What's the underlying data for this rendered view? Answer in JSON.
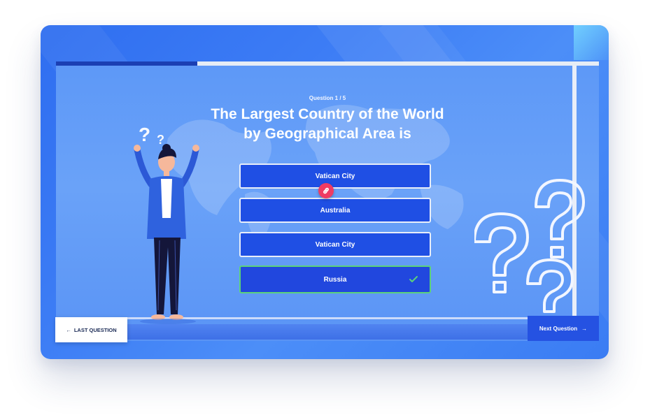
{
  "quiz": {
    "counter": "Question 1 / 5",
    "question_line1": "The Largest Country of the World",
    "question_line2": "by Geographical Area is",
    "progress_fraction": 0.26,
    "answers": [
      {
        "label": "Vatican City",
        "state": "default"
      },
      {
        "label": "Australia",
        "state": "default"
      },
      {
        "label": "Vatican City",
        "state": "default"
      },
      {
        "label": "Russia",
        "state": "correct"
      }
    ]
  },
  "nav": {
    "last_label": "LAST QUESTION",
    "next_label": "Next Question"
  },
  "icons": {
    "link": "link-icon",
    "check": "check-icon",
    "arrow_left": "arrow-left-icon",
    "arrow_right": "arrow-right-icon"
  },
  "colors": {
    "accent": "#1f4fe4",
    "correct": "#5cd17a",
    "badge": "#ef3b63"
  }
}
